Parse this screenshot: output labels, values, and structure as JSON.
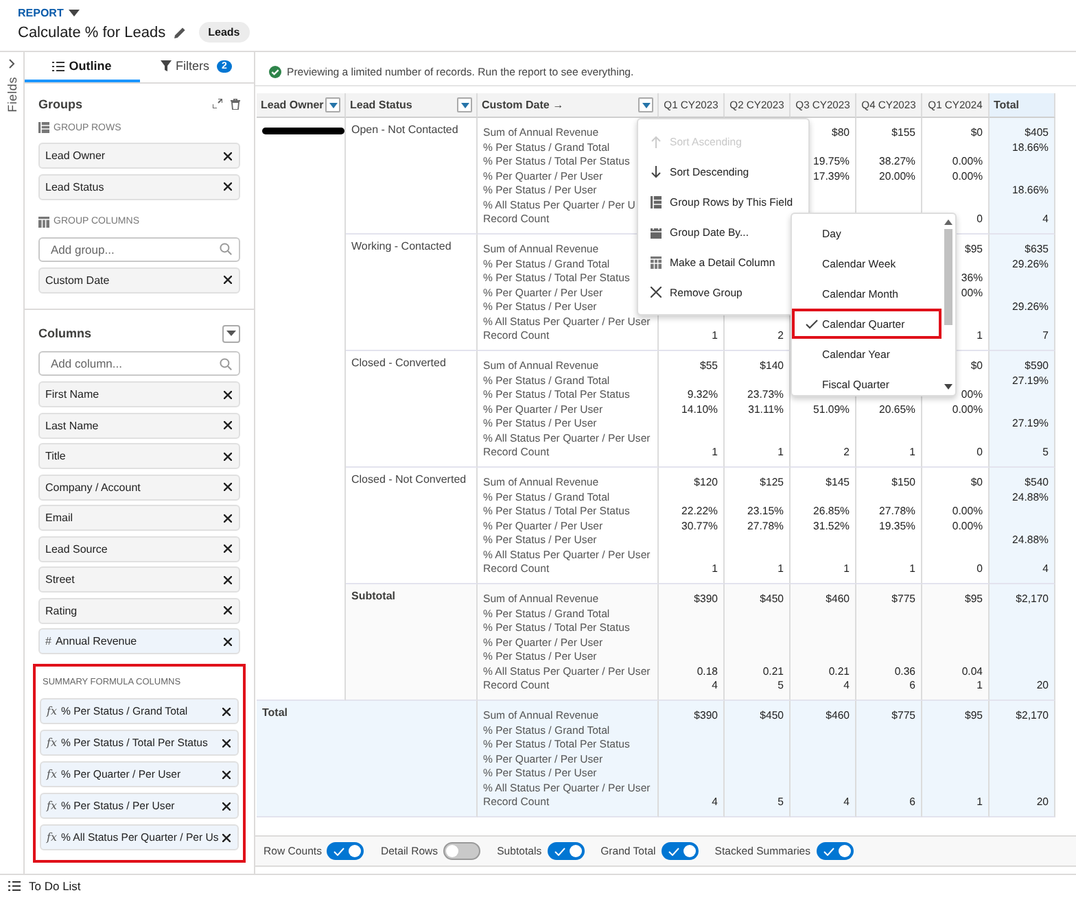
{
  "header": {
    "eyebrow": "REPORT",
    "title": "Calculate % for Leads",
    "badge": "Leads"
  },
  "fields_strip": {
    "label": "Fields"
  },
  "left_panel": {
    "tabs": [
      {
        "label": "Outline",
        "selected": true
      },
      {
        "label": "Filters",
        "selected": false,
        "badge": "2"
      }
    ],
    "groups": {
      "title": "Groups",
      "rows_label": "GROUP ROWS",
      "rows": [
        "Lead Owner",
        "Lead Status"
      ],
      "columns_label": "GROUP COLUMNS",
      "add_placeholder": "Add group...",
      "columns": [
        "Custom Date"
      ]
    },
    "columns": {
      "title": "Columns",
      "add_placeholder": "Add column...",
      "items": [
        {
          "label": "First Name"
        },
        {
          "label": "Last Name"
        },
        {
          "label": "Title"
        },
        {
          "label": "Company / Account"
        },
        {
          "label": "Email"
        },
        {
          "label": "Lead Source"
        },
        {
          "label": "Street"
        },
        {
          "label": "Rating"
        },
        {
          "label": "Annual Revenue",
          "icon": "#"
        }
      ]
    },
    "summary": {
      "title": "SUMMARY FORMULA COLUMNS",
      "highlighted": true,
      "items": [
        {
          "label": "% Per Status / Grand Total",
          "icon": "fx"
        },
        {
          "label": "% Per Status / Total Per Status",
          "icon": "fx"
        },
        {
          "label": "% Per Quarter / Per User",
          "icon": "fx"
        },
        {
          "label": "% Per Status / Per User",
          "icon": "fx"
        },
        {
          "label": "% All Status Per Quarter / Per Us",
          "icon": "fx"
        }
      ]
    }
  },
  "main": {
    "banner": "Previewing a limited number of records. Run the report to see everything.",
    "table": {
      "owner_redacted": true,
      "columns": [
        {
          "label": "Lead Owner",
          "menu": true
        },
        {
          "label": "Lead Status",
          "menu": true
        },
        {
          "label": "Custom Date →",
          "menu": true
        },
        {
          "label": "Q1 CY2023",
          "menu": false
        },
        {
          "label": "Q2 CY2023",
          "menu": false
        },
        {
          "label": "Q3 CY2023",
          "menu": false
        },
        {
          "label": "Q4 CY2023",
          "menu": false
        },
        {
          "label": "Q1 CY2024",
          "menu": false
        },
        {
          "label": "Total",
          "menu": false
        }
      ],
      "rows": [
        {
          "kind": "group",
          "status": "Open - Not Contacted",
          "measures": [
            "Sum of Annual Revenue",
            "% Per Status / Grand Total",
            "% Per Status / Total Per Status",
            "% Per Quarter / Per User",
            "% Per Status / Per User",
            "% All Status Per Quarter / Per U",
            "Record Count"
          ],
          "values": {
            "q3_cy2023": {
              "sum": "$80",
              "status_total": "19.75%",
              "quarter_user": "17.39%"
            },
            "q4_cy2023": {
              "sum": "$155",
              "status_total": "38.27%",
              "quarter_user": "20.00%"
            },
            "q1_cy2024": {
              "sum": "$0",
              "status_total": "0.00%",
              "quarter_user": "0.00%",
              "count": "0"
            },
            "total": {
              "sum": "$405",
              "grand": "18.66%",
              "status_user": "18.66%",
              "count": "4"
            }
          }
        },
        {
          "kind": "group",
          "status": "Working - Contacted",
          "measures": [
            "Sum of Annual Revenue",
            "% Per Status / Grand Total",
            "% Per Status / Total Per Status",
            "% Per Quarter / Per User",
            "% Per Status / Per User",
            "% All Status Per Quarter / Per User",
            "Record Count"
          ],
          "values": {
            "q1_cy2023": {
              "count": "1"
            },
            "q2_cy2023": {
              "count": "2"
            },
            "q1_cy2024": {
              "sum": "$95",
              "status_total": "36%",
              "quarter_user": "00%",
              "count": "1"
            },
            "total": {
              "sum": "$635",
              "grand": "29.26%",
              "status_user": "29.26%",
              "count": "7"
            }
          }
        },
        {
          "kind": "group",
          "status": "Closed - Converted",
          "measures": [
            "Sum of Annual Revenue",
            "% Per Status / Grand Total",
            "% Per Status / Total Per Status",
            "% Per Quarter / Per User",
            "% Per Status / Per User",
            "% All Status Per Quarter / Per User",
            "Record Count"
          ],
          "values": {
            "q1_cy2023": {
              "sum": "$55",
              "status_total": "9.32%",
              "quarter_user": "14.10%",
              "count": "1"
            },
            "q2_cy2023": {
              "sum": "$140",
              "status_total": "23.73%",
              "quarter_user": "31.11%",
              "count": "1"
            },
            "q3_cy2023": {
              "quarter_user": "51.09%",
              "count": "2"
            },
            "q4_cy2023": {
              "quarter_user": "20.65%",
              "count": "1"
            },
            "q1_cy2024": {
              "sum": "$0",
              "status_total": "00%",
              "quarter_user": "0.00%",
              "count": "0"
            },
            "total": {
              "sum": "$590",
              "grand": "27.19%",
              "status_user": "27.19%",
              "count": "5"
            }
          }
        },
        {
          "kind": "group",
          "status": "Closed - Not Converted",
          "measures": [
            "Sum of Annual Revenue",
            "% Per Status / Grand Total",
            "% Per Status / Total Per Status",
            "% Per Quarter / Per User",
            "% Per Status / Per User",
            "% All Status Per Quarter / Per User",
            "Record Count"
          ],
          "values": {
            "q1_cy2023": {
              "sum": "$120",
              "status_total": "22.22%",
              "quarter_user": "30.77%",
              "count": "1"
            },
            "q2_cy2023": {
              "sum": "$125",
              "status_total": "23.15%",
              "quarter_user": "27.78%",
              "count": "1"
            },
            "q3_cy2023": {
              "sum": "$145",
              "status_total": "26.85%",
              "quarter_user": "31.52%",
              "count": "1"
            },
            "q4_cy2023": {
              "sum": "$150",
              "status_total": "27.78%",
              "quarter_user": "19.35%",
              "count": "1"
            },
            "q1_cy2024": {
              "sum": "$0",
              "status_total": "0.00%",
              "quarter_user": "0.00%",
              "count": "0"
            },
            "total": {
              "sum": "$540",
              "grand": "24.88%",
              "status_user": "24.88%",
              "count": "4"
            }
          }
        },
        {
          "kind": "subtotal",
          "status": "Subtotal",
          "measures": [
            "Sum of Annual Revenue",
            "% Per Status / Grand Total",
            "% Per Status / Total Per Status",
            "% Per Quarter / Per User",
            "% Per Status / Per User",
            "% All Status Per Quarter / Per User",
            "Record Count"
          ],
          "values": {
            "q1_cy2023": {
              "sum": "$390",
              "all_status": "0.18",
              "count": "4"
            },
            "q2_cy2023": {
              "sum": "$450",
              "all_status": "0.21",
              "count": "5"
            },
            "q3_cy2023": {
              "sum": "$460",
              "all_status": "0.21",
              "count": "4"
            },
            "q4_cy2023": {
              "sum": "$775",
              "all_status": "0.36",
              "count": "6"
            },
            "q1_cy2024": {
              "sum": "$95",
              "all_status": "0.04",
              "count": "1"
            },
            "total": {
              "sum": "$2,170",
              "count": "20"
            }
          }
        },
        {
          "kind": "total",
          "owner": "Total",
          "measures": [
            "Sum of Annual Revenue",
            "% Per Status / Grand Total",
            "% Per Status / Total Per Status",
            "% Per Quarter / Per User",
            "% Per Status / Per User",
            "% All Status Per Quarter / Per User",
            "Record Count"
          ],
          "values": {
            "q1_cy2023": {
              "sum": "$390",
              "count": "4"
            },
            "q2_cy2023": {
              "sum": "$450",
              "count": "5"
            },
            "q3_cy2023": {
              "sum": "$460",
              "count": "4"
            },
            "q4_cy2023": {
              "sum": "$775",
              "count": "6"
            },
            "q1_cy2024": {
              "sum": "$95",
              "count": "1"
            },
            "total": {
              "sum": "$2,170",
              "count": "20"
            }
          }
        }
      ]
    },
    "column_menu": {
      "items": [
        {
          "kind": "sort-up",
          "label": "Sort Ascending",
          "disabled": true
        },
        {
          "kind": "sort-down",
          "label": "Sort Descending",
          "disabled": false
        },
        {
          "kind": "group-rows",
          "label": "Group Rows by This Field",
          "disabled": false
        },
        {
          "kind": "group-date",
          "label": "Group Date By...",
          "disabled": false,
          "submenu": true
        },
        {
          "kind": "detail-column",
          "label": "Make a Detail Column",
          "disabled": false
        },
        {
          "kind": "remove",
          "label": "Remove Group",
          "disabled": false
        }
      ]
    },
    "date_submenu": {
      "items": [
        {
          "label": "Day",
          "selected": false,
          "highlighted": false
        },
        {
          "label": "Calendar Week",
          "selected": false,
          "highlighted": false
        },
        {
          "label": "Calendar Month",
          "selected": false,
          "highlighted": false
        },
        {
          "label": "Calendar Quarter",
          "selected": true,
          "highlighted": true
        },
        {
          "label": "Calendar Year",
          "selected": false,
          "highlighted": false
        },
        {
          "label": "Fiscal Quarter",
          "selected": false,
          "highlighted": false
        }
      ]
    },
    "toolbar": {
      "toggles": [
        {
          "label": "Row Counts",
          "on": true
        },
        {
          "label": "Detail Rows",
          "on": false
        },
        {
          "label": "Subtotals",
          "on": true
        },
        {
          "label": "Grand Total",
          "on": true
        },
        {
          "label": "Stacked Summaries",
          "on": true
        }
      ]
    }
  },
  "footer": {
    "label": "To Do List"
  }
}
